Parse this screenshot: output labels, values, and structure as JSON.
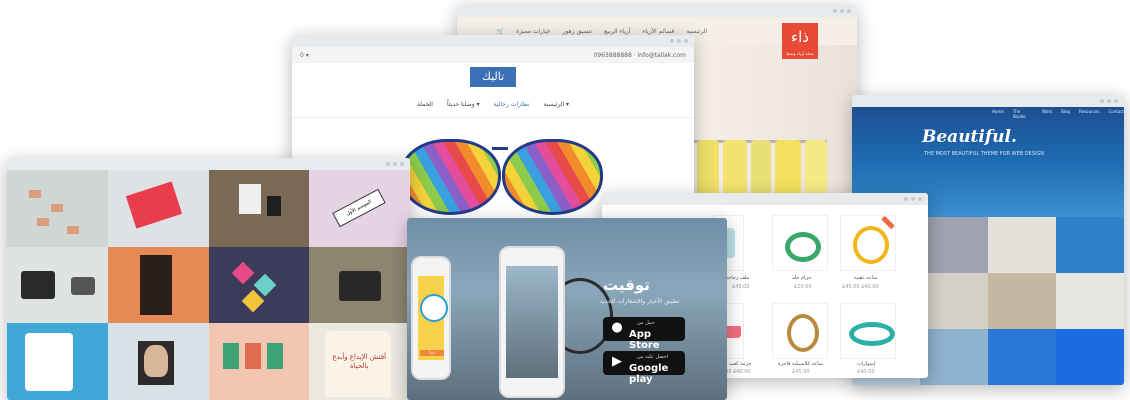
{
  "fashion": {
    "nav": [
      "الرئيسية",
      "قسائم الأزياء",
      "أزياء الربيع",
      "تنسيق زهور",
      "خيارات مميزة"
    ],
    "logo_main": "ذاء",
    "logo_sub": "مجلة أزياء ونمط"
  },
  "glasses": {
    "topbar_left": "0 ▾",
    "topbar_right": "0963888888 · info@tallak.com",
    "logo": "تاليك",
    "menu": [
      "الرئيسية ▾",
      "نظارات رجالية",
      "وصلنا حديثاً ▾",
      "الحملة"
    ]
  },
  "ocean": {
    "title": "Beautiful.",
    "subtitle": "THE MOST BEAUTIFUL THEME FOR WEB DESIGN",
    "links": [
      "Home",
      "The Studio",
      "Work",
      "Blog",
      "Resources",
      "Contact"
    ]
  },
  "grid": {
    "ribbon_text": "الموسم الأول",
    "tshirt_text": "أفتش الإبداع وأبدع بالحياة",
    "tiles_colors": [
      "#cfd6d3",
      "#e93c4c",
      "#7a6a55",
      "#e7d3e6",
      "#dfe4e1",
      "#e58a56",
      "#3b3c5a",
      "#8d8570",
      "#3fa8d6",
      "#d8e2e6",
      "#f2c6b0",
      "#ece9e2"
    ]
  },
  "app": {
    "title": "توقيت",
    "subtitle": "تطبيق الأخبار والإشعارات الجديد",
    "appstore_small": "حمل من",
    "appstore_label": "App Store",
    "google_small": "احصل عليه من",
    "google_label": "Google play",
    "orange_button": "ابدأ"
  },
  "shop": {
    "products": [
      {
        "name": "ساعة ذهبية",
        "price": "£40.00",
        "old": "£45.00 £40.00"
      },
      {
        "name": "حزام جلد",
        "price": "£20.00"
      },
      {
        "name": "ملف زجاجي",
        "price": "£45.00"
      },
      {
        "name": "إسوارات",
        "price": "£40.00"
      },
      {
        "name": "ساعة كلاسيكية فاخرة",
        "price": "£45.00"
      },
      {
        "name": "جزمة كعب عالي",
        "price": "£45.00 £40.00"
      }
    ]
  }
}
